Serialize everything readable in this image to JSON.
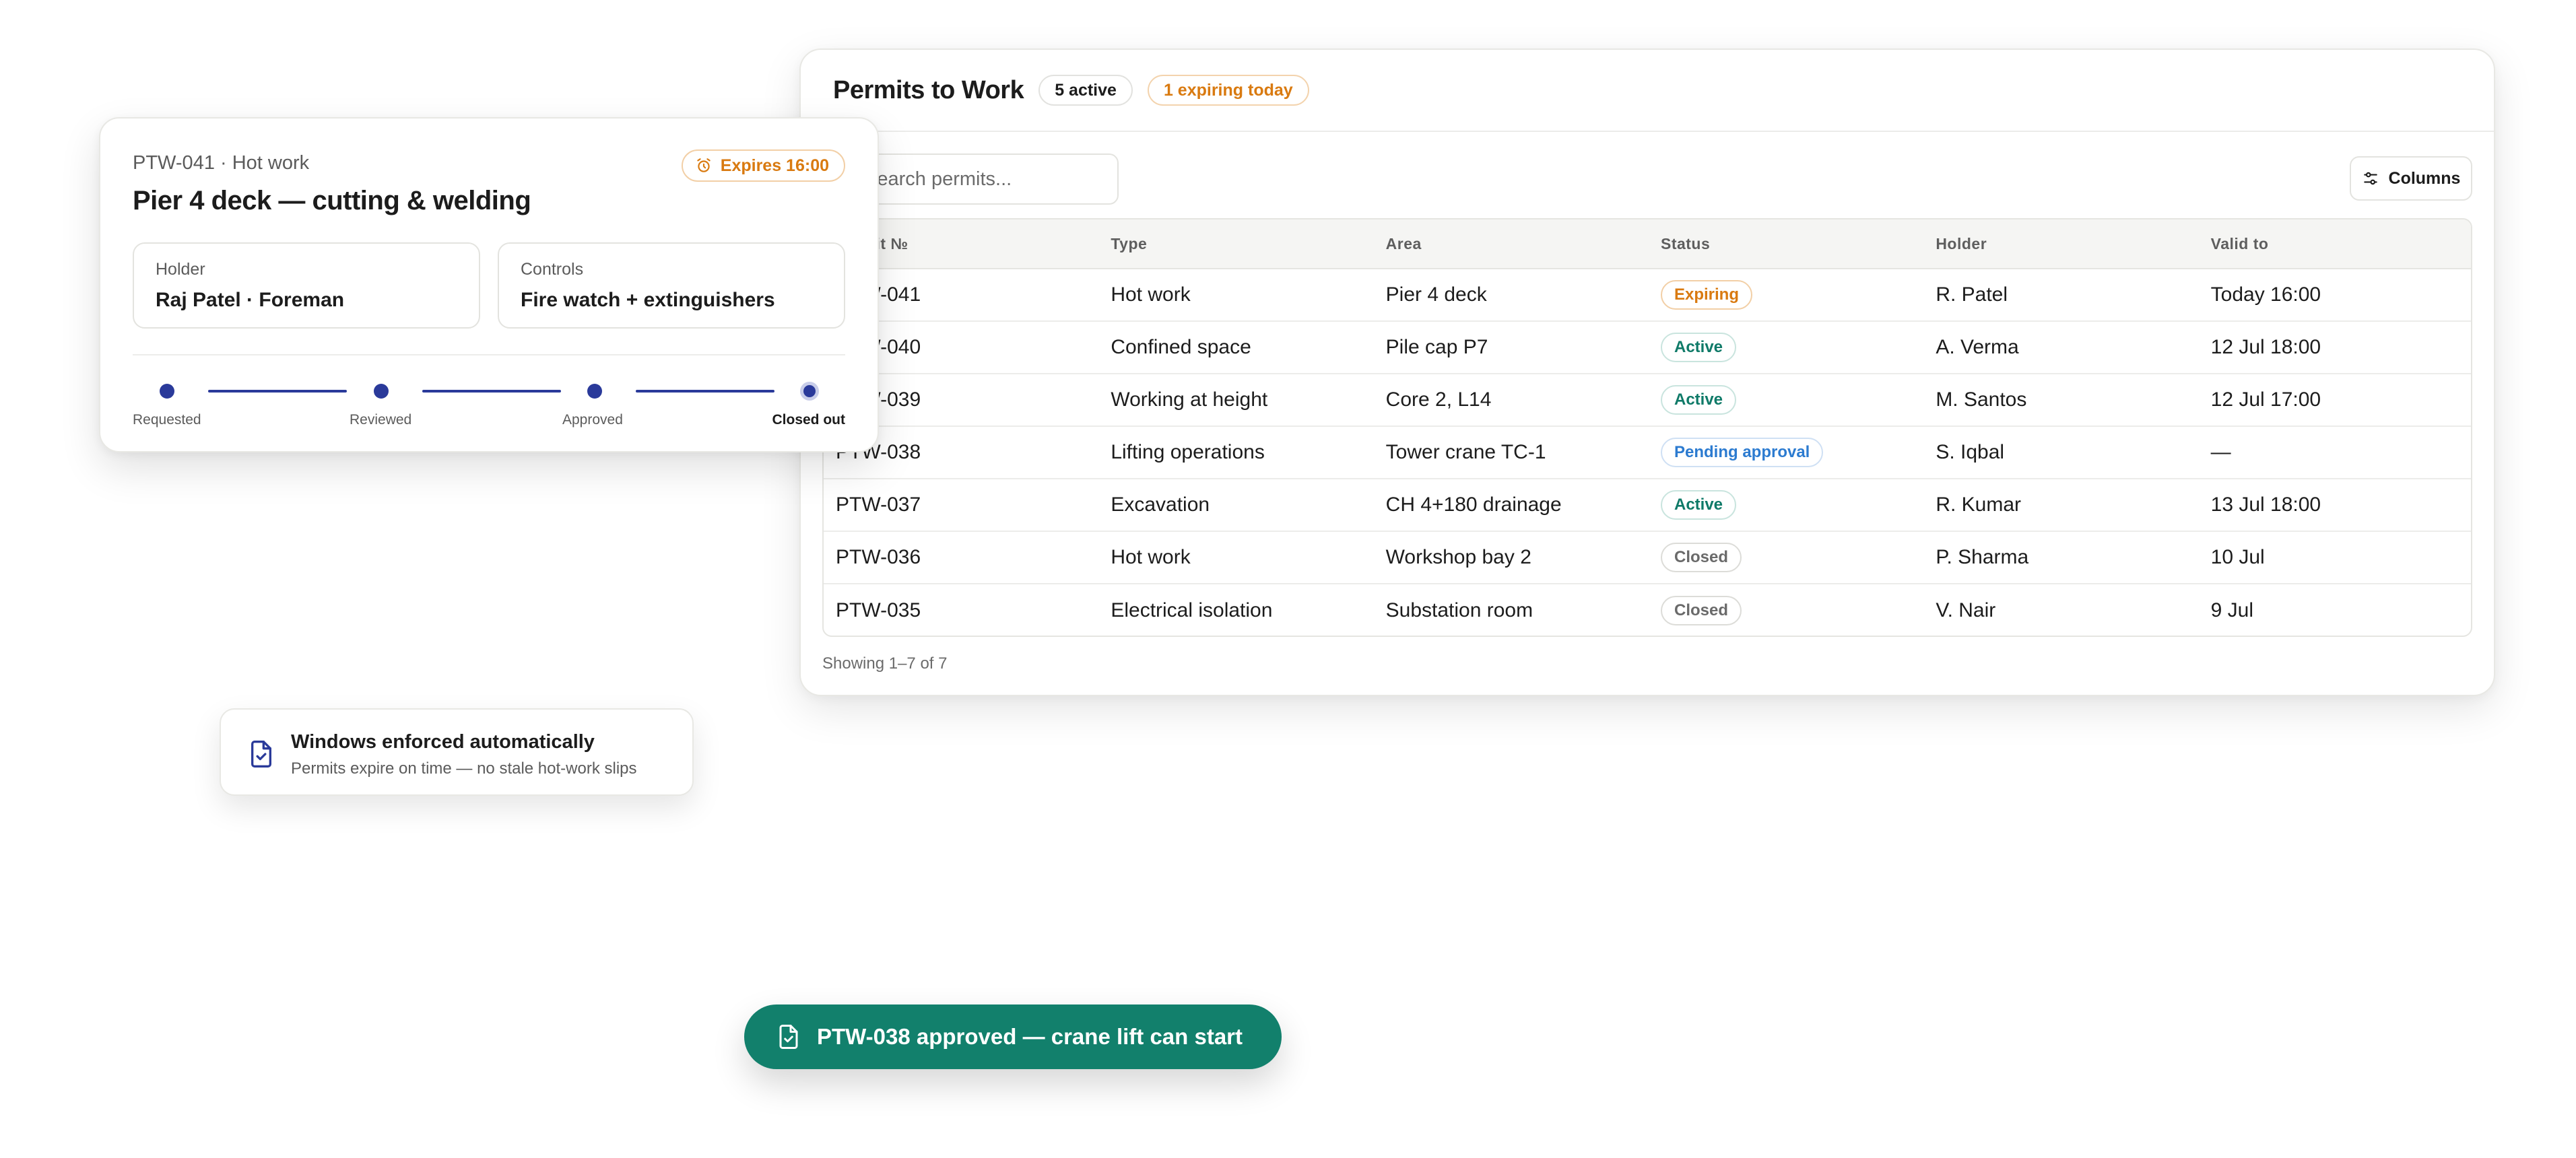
{
  "colors": {
    "accent_navy": "#2a3a9a",
    "expiring_orange": "#d97a10",
    "active_teal": "#0f7a68",
    "pending_blue": "#2c7bd0",
    "toast_green": "#12806c"
  },
  "main": {
    "title": "Permits to Work",
    "active_pill": "5 active",
    "expiring_pill": "1 expiring today",
    "search_placeholder": "Search permits...",
    "columns_label": "Columns",
    "headers": [
      "Permit №",
      "Type",
      "Area",
      "Status",
      "Holder",
      "Valid to"
    ],
    "rows": [
      {
        "id": "PTW-041",
        "type": "Hot work",
        "area": "Pier 4 deck",
        "status": "Expiring",
        "status_kind": "expiring",
        "holder": "R. Patel",
        "valid_to": "Today 16:00"
      },
      {
        "id": "PTW-040",
        "type": "Confined space",
        "area": "Pile cap P7",
        "status": "Active",
        "status_kind": "active",
        "holder": "A. Verma",
        "valid_to": "12 Jul 18:00"
      },
      {
        "id": "PTW-039",
        "type": "Working at height",
        "area": "Core 2, L14",
        "status": "Active",
        "status_kind": "active",
        "holder": "M. Santos",
        "valid_to": "12 Jul 17:00"
      },
      {
        "id": "PTW-038",
        "type": "Lifting operations",
        "area": "Tower crane TC-1",
        "status": "Pending approval",
        "status_kind": "pending",
        "holder": "S. Iqbal",
        "valid_to": "—"
      },
      {
        "id": "PTW-037",
        "type": "Excavation",
        "area": "CH 4+180 drainage",
        "status": "Active",
        "status_kind": "active",
        "holder": "R. Kumar",
        "valid_to": "13 Jul 18:00"
      },
      {
        "id": "PTW-036",
        "type": "Hot work",
        "area": "Workshop bay 2",
        "status": "Closed",
        "status_kind": "closed",
        "holder": "P. Sharma",
        "valid_to": "10 Jul"
      },
      {
        "id": "PTW-035",
        "type": "Electrical isolation",
        "area": "Substation room",
        "status": "Closed",
        "status_kind": "closed",
        "holder": "V. Nair",
        "valid_to": "9 Jul"
      }
    ],
    "footer": "Showing 1–7 of 7"
  },
  "detail": {
    "subtitle": "PTW-041 · Hot work",
    "expires": "Expires 16:00",
    "title": "Pier 4 deck — cutting & welding",
    "holder_label": "Holder",
    "holder_value": "Raj Patel · Foreman",
    "controls_label": "Controls",
    "controls_value": "Fire watch + extinguishers",
    "steps": [
      "Requested",
      "Reviewed",
      "Approved",
      "Closed out"
    ]
  },
  "note": {
    "title": "Windows enforced automatically",
    "subtitle": "Permits expire on time — no stale hot-work slips"
  },
  "toast": {
    "text": "PTW-038 approved — crane lift can start"
  }
}
